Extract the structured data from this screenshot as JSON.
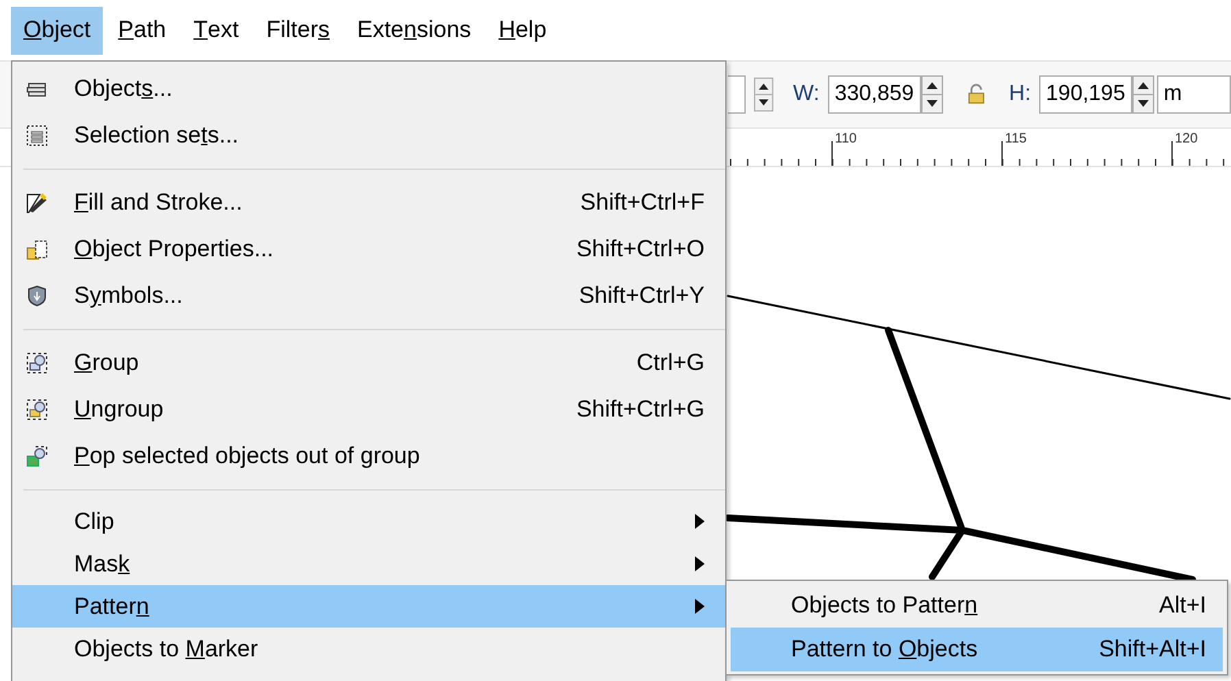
{
  "menubar": [
    {
      "label": {
        "key": "O",
        "post": "bject"
      },
      "selected": true
    },
    {
      "label": {
        "key": "P",
        "post": "ath"
      },
      "selected": false
    },
    {
      "label": {
        "key": "T",
        "post": "ext"
      },
      "selected": false
    },
    {
      "label": {
        "pre": "Filter",
        "key": "s"
      },
      "selected": false
    },
    {
      "label": {
        "pre": "Exte",
        "key": "n",
        "post": "sions"
      },
      "selected": false
    },
    {
      "label": {
        "key": "H",
        "post": "elp"
      },
      "selected": false
    }
  ],
  "toolbar": {
    "width_label": "W:",
    "width_value": "330,859",
    "height_label": "H:",
    "height_value": "190,195",
    "unit": "m"
  },
  "ruler": {
    "labels": [
      "110",
      "115",
      "120"
    ]
  },
  "menu": {
    "items": [
      {
        "kind": "item",
        "icon": true,
        "label": {
          "pre": "Object",
          "key": "s",
          "post": "..."
        },
        "selected": false
      },
      {
        "kind": "item",
        "icon": true,
        "label": {
          "pre": "Selection se",
          "key": "t",
          "post": "s..."
        },
        "selected": false
      },
      {
        "kind": "separator"
      },
      {
        "kind": "item",
        "icon": true,
        "label": {
          "key": "F",
          "post": "ill and Stroke..."
        },
        "shortcut": "Shift+Ctrl+F",
        "selected": false
      },
      {
        "kind": "item",
        "icon": true,
        "label": {
          "key": "O",
          "post": "bject Properties..."
        },
        "shortcut": "Shift+Ctrl+O",
        "selected": false
      },
      {
        "kind": "item",
        "icon": true,
        "label": {
          "pre": "S",
          "key": "y",
          "post": "mbols..."
        },
        "shortcut": "Shift+Ctrl+Y",
        "selected": false
      },
      {
        "kind": "separator"
      },
      {
        "kind": "item",
        "icon": true,
        "label": {
          "key": "G",
          "post": "roup"
        },
        "shortcut": "Ctrl+G",
        "selected": false
      },
      {
        "kind": "item",
        "icon": true,
        "label": {
          "key": "U",
          "post": "ngroup"
        },
        "shortcut": "Shift+Ctrl+G",
        "selected": false
      },
      {
        "kind": "item",
        "icon": true,
        "label": {
          "key": "P",
          "post": "op selected objects out of group"
        },
        "selected": false
      },
      {
        "kind": "separator"
      },
      {
        "kind": "submenu",
        "icon": false,
        "label": {
          "pre": "Clip"
        },
        "selected": false
      },
      {
        "kind": "submenu",
        "icon": false,
        "label": {
          "pre": "Mas",
          "key": "k"
        },
        "selected": false
      },
      {
        "kind": "submenu",
        "icon": false,
        "label": {
          "pre": "Patter",
          "key": "n"
        },
        "selected": true
      },
      {
        "kind": "item",
        "icon": false,
        "label": {
          "pre": "Objects to ",
          "key": "M",
          "post": "arker"
        },
        "selected": false
      }
    ]
  },
  "submenu": {
    "items": [
      {
        "kind": "item",
        "label": {
          "pre": "Objects to Patter",
          "key": "n"
        },
        "shortcut": "Alt+I",
        "selected": false
      },
      {
        "kind": "item",
        "label": {
          "pre": "Pattern to ",
          "key": "O",
          "post": "bjects"
        },
        "shortcut": "Shift+Alt+I",
        "selected": true
      }
    ]
  }
}
